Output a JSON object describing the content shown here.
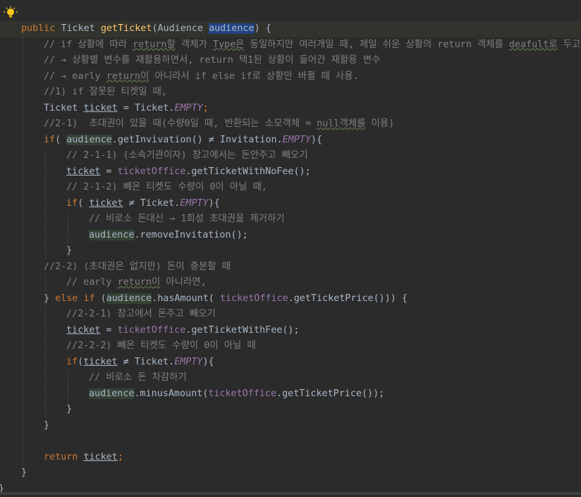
{
  "editor": {
    "lines": [
      {
        "id": "l1",
        "indent": 0,
        "parts": [
          [
            "kw",
            "public "
          ],
          [
            "plain",
            "Ticket "
          ],
          [
            "fn",
            "getTicket"
          ],
          [
            "plain",
            "(Audience "
          ],
          [
            "sel",
            "audience"
          ],
          [
            "plain",
            ") {"
          ]
        ]
      },
      {
        "id": "l2",
        "indent": 1,
        "parts": [
          [
            "cm",
            "// if 상황에 따라 "
          ],
          [
            "cmtypo",
            "return할"
          ],
          [
            "cm",
            " 객체가 "
          ],
          [
            "cmtypo",
            "Type은"
          ],
          [
            "cm",
            " 동일하지만 여러개일 때, 제일 쉬운 상황의 return 객체를 "
          ],
          [
            "cmtypo",
            "deafult로"
          ],
          [
            "cm",
            " 두고"
          ]
        ]
      },
      {
        "id": "l3",
        "indent": 1,
        "parts": [
          [
            "cm",
            "// → 상황별 변수를 재활용하면서, return 택1된 상황이 들어간 재활용 변수"
          ]
        ]
      },
      {
        "id": "l4",
        "indent": 1,
        "parts": [
          [
            "cm",
            "// → early "
          ],
          [
            "cmtypo",
            "return이"
          ],
          [
            "cm",
            " 아니라서 if else if로 상황만 바뀔 때 사용."
          ]
        ]
      },
      {
        "id": "l5",
        "indent": 1,
        "parts": [
          [
            "cm",
            "//1) if 잘못된 티켓일 때,"
          ]
        ]
      },
      {
        "id": "l6",
        "indent": 1,
        "parts": [
          [
            "plain",
            "Ticket "
          ],
          [
            "ul",
            "ticket"
          ],
          [
            "plain",
            " = Ticket."
          ],
          [
            "cst",
            "EMPTY"
          ],
          [
            "kw",
            ";"
          ]
        ]
      },
      {
        "id": "l7",
        "indent": 1,
        "parts": [
          [
            "cm",
            "//2-1)  초대권이 있을 때(수량0일 때, 반환되는 소모객체 = "
          ],
          [
            "cmtypo",
            "null객체를"
          ],
          [
            "cm",
            " 이용)"
          ]
        ]
      },
      {
        "id": "l8",
        "indent": 1,
        "parts": [
          [
            "kw",
            "if"
          ],
          [
            "plain",
            "( "
          ],
          [
            "param",
            "audience"
          ],
          [
            "plain",
            "."
          ],
          [
            "plain",
            "getInvivation() ≠ Invitation."
          ],
          [
            "cst",
            "EMPTY"
          ],
          [
            "plain",
            "){"
          ]
        ]
      },
      {
        "id": "l9",
        "indent": 2,
        "parts": [
          [
            "cm",
            "// 2-1-1) (소속기관이자) 창고에서는 돈안주고 빼오기"
          ]
        ]
      },
      {
        "id": "l10",
        "indent": 2,
        "parts": [
          [
            "ul",
            "ticket"
          ],
          [
            "plain",
            " = "
          ],
          [
            "fld",
            "ticketOffice"
          ],
          [
            "plain",
            ".getTicketWithNoFee();"
          ]
        ]
      },
      {
        "id": "l11",
        "indent": 2,
        "parts": [
          [
            "cm",
            "// 2-1-2) 빼온 티켓도 수량이 0이 아닐 때,"
          ]
        ]
      },
      {
        "id": "l12",
        "indent": 2,
        "parts": [
          [
            "kw",
            "if"
          ],
          [
            "plain",
            "( "
          ],
          [
            "ul",
            "ticket"
          ],
          [
            "plain",
            " ≠ Ticket."
          ],
          [
            "cst",
            "EMPTY"
          ],
          [
            "plain",
            "){"
          ]
        ]
      },
      {
        "id": "l13",
        "indent": 3,
        "parts": [
          [
            "cm",
            "// 비로소 돈대신 → 1회성 초대권을 제거하기"
          ]
        ]
      },
      {
        "id": "l14",
        "indent": 3,
        "parts": [
          [
            "param",
            "audience"
          ],
          [
            "plain",
            ".removeInvitation();"
          ]
        ]
      },
      {
        "id": "l15",
        "indent": 2,
        "parts": [
          [
            "plain",
            "}"
          ]
        ]
      },
      {
        "id": "l16",
        "indent": 1,
        "parts": [
          [
            "cm",
            "//2-2) (초대권은 없지만) 돈이 충분할 때"
          ]
        ]
      },
      {
        "id": "l17",
        "indent": 2,
        "parts": [
          [
            "cm",
            "// early "
          ],
          [
            "cmtypo",
            "return이"
          ],
          [
            "cm",
            " 아니라면,"
          ]
        ]
      },
      {
        "id": "l18",
        "indent": 1,
        "parts": [
          [
            "plain",
            "} "
          ],
          [
            "kw",
            "else if "
          ],
          [
            "plain",
            "("
          ],
          [
            "param",
            "audience"
          ],
          [
            "plain",
            ".hasAmount( "
          ],
          [
            "fld",
            "ticketOffice"
          ],
          [
            "plain",
            ".getTicketPrice())) {"
          ]
        ]
      },
      {
        "id": "l19",
        "indent": 2,
        "parts": [
          [
            "cm",
            "//2-2-1) 창고에서 돈주고 빼오기"
          ]
        ]
      },
      {
        "id": "l20",
        "indent": 2,
        "parts": [
          [
            "ul",
            "ticket"
          ],
          [
            "plain",
            " = "
          ],
          [
            "fld",
            "ticketOffice"
          ],
          [
            "plain",
            ".getTicketWithFee();"
          ]
        ]
      },
      {
        "id": "l21",
        "indent": 2,
        "parts": [
          [
            "cm",
            "//2-2-2) 빼온 티켓도 수량이 0이 아닐 때"
          ]
        ]
      },
      {
        "id": "l22",
        "indent": 2,
        "parts": [
          [
            "kw",
            "if"
          ],
          [
            "plain",
            "("
          ],
          [
            "ul",
            "ticket"
          ],
          [
            "plain",
            " ≠ Ticket."
          ],
          [
            "cst",
            "EMPTY"
          ],
          [
            "plain",
            "){"
          ]
        ]
      },
      {
        "id": "l23",
        "indent": 3,
        "parts": [
          [
            "cm",
            "// 비로소 돈 차감하기"
          ]
        ]
      },
      {
        "id": "l24",
        "indent": 3,
        "parts": [
          [
            "param",
            "audience"
          ],
          [
            "plain",
            ".minusAmount("
          ],
          [
            "fld",
            "ticketOffice"
          ],
          [
            "plain",
            ".getTicketPrice());"
          ]
        ]
      },
      {
        "id": "l25",
        "indent": 2,
        "parts": [
          [
            "plain",
            "}"
          ]
        ]
      },
      {
        "id": "l26",
        "indent": 1,
        "parts": [
          [
            "plain",
            "}"
          ]
        ]
      },
      {
        "id": "l27",
        "indent": 1,
        "parts": []
      },
      {
        "id": "l28",
        "indent": 1,
        "parts": [
          [
            "kw",
            "return "
          ],
          [
            "ul",
            "ticket"
          ],
          [
            "kw",
            ";"
          ]
        ]
      },
      {
        "id": "l29",
        "indent": 0,
        "parts": [
          [
            "plain",
            "}"
          ]
        ]
      },
      {
        "id": "l30",
        "indent": -1,
        "parts": [
          [
            "plain",
            "}"
          ]
        ]
      }
    ],
    "colors": {
      "background": "#2b2b2b",
      "keyword": "#cc7832",
      "method": "#ffc66d",
      "field": "#9876aa",
      "comment": "#808080",
      "text": "#a9b7c6",
      "selection": "#214283",
      "param_highlight": "#344134"
    },
    "gutter_icon": "lightbulb-icon"
  }
}
